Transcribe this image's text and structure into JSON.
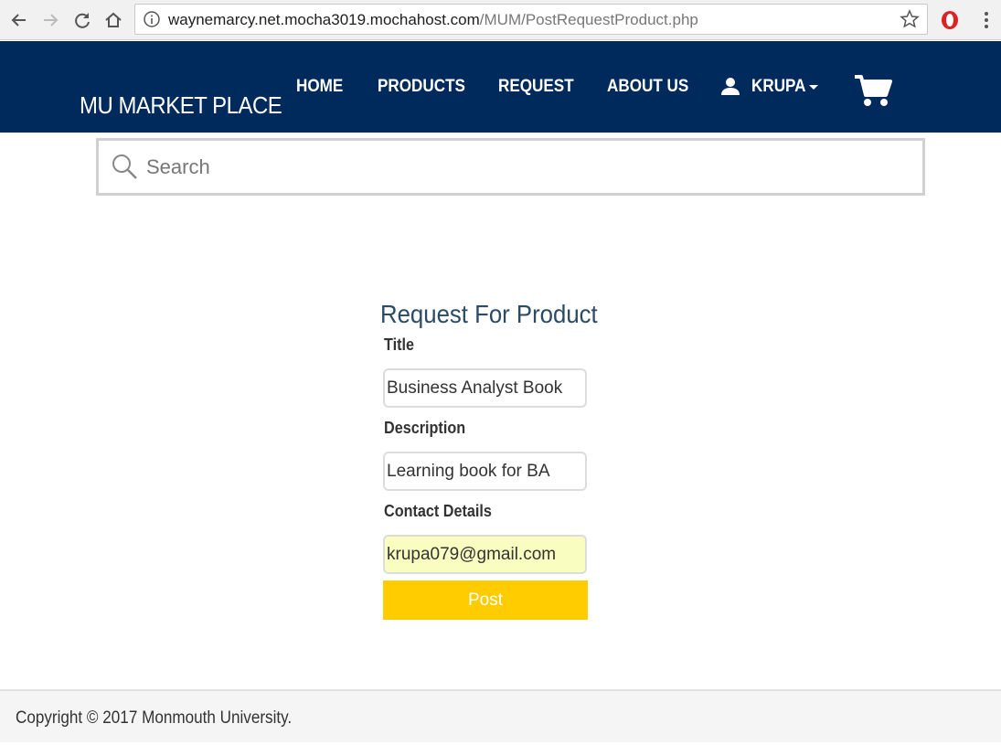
{
  "browser": {
    "url_host": "waynemarcy.net.mocha3019.mochahost.com",
    "url_path": "/MUM/PostRequestProduct.php"
  },
  "header": {
    "brand": "MU MARKET PLACE",
    "nav": {
      "home": "HOME",
      "products": "PRODUCTS",
      "request": "REQUEST",
      "about": "ABOUT US"
    },
    "user": "KRUPA",
    "bg_color": "#002a5c"
  },
  "search": {
    "placeholder": "Search"
  },
  "form": {
    "title": "Request For Product",
    "title_label": "Title",
    "title_value": "Business Analyst Book",
    "description_label": "Description",
    "description_value": "Learning book for BA",
    "contact_label": "Contact Details",
    "contact_value": "krupa079@gmail.com",
    "submit_label": "Post",
    "submit_color": "#ffcc00"
  },
  "footer": {
    "copyright": "Copyright © 2017 Monmouth University."
  }
}
